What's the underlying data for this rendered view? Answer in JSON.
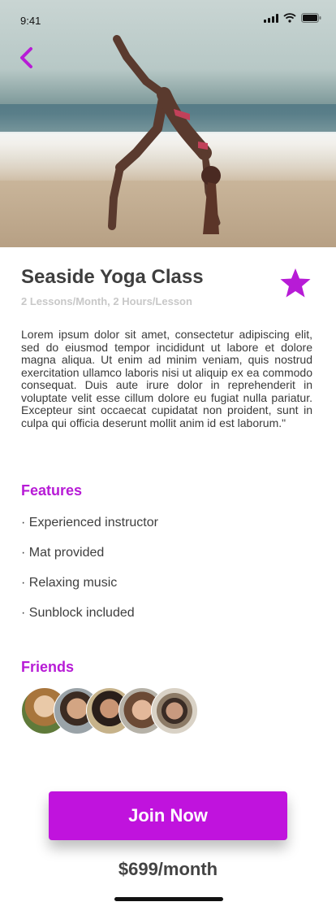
{
  "status_bar": {
    "time": "9:41"
  },
  "header": {
    "back_icon": "chevron-left-icon"
  },
  "class": {
    "title": "Seaside Yoga Class",
    "subtitle": "2 Lessons/Month, 2 Hours/Lesson",
    "favorite_icon": "star-icon",
    "description": "Lorem ipsum dolor sit amet, consectetur adipiscing elit, sed do eiusmod tempor incididunt ut labore et dolore magna aliqua. Ut enim ad minim veniam, quis nostrud exercitation ullamco laboris nisi ut aliquip ex ea commodo consequat. Duis aute irure dolor in reprehenderit in voluptate velit esse cillum dolore eu fugiat nulla pariatur. Excepteur sint occaecat cupidatat non proident, sunt in culpa qui officia deserunt mollit anim id est laborum.\""
  },
  "features": {
    "heading": "Features",
    "items": [
      "· Experienced instructor",
      "· Mat provided",
      "· Relaxing music",
      "· Sunblock included"
    ]
  },
  "friends": {
    "heading": "Friends",
    "count": 5
  },
  "cta": {
    "join_label": "Join Now",
    "price": "$699/month"
  },
  "colors": {
    "accent": "#b71bd6",
    "button": "#c013dd",
    "title": "#3e3e3e",
    "subtitle": "#c8c8c8"
  }
}
